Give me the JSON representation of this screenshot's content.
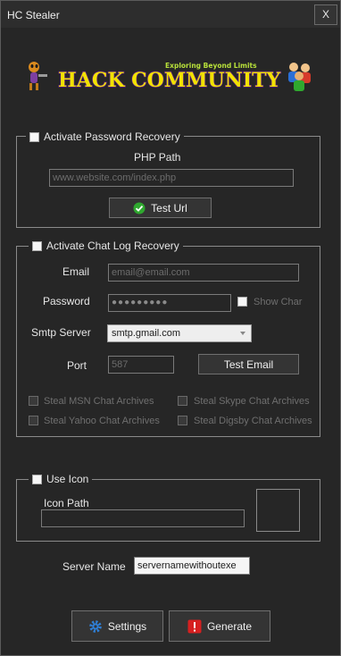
{
  "window": {
    "title": "HC Stealer",
    "close_label": "X"
  },
  "logo": {
    "tagline": "Exploring Beyond Limits",
    "brand": "HACK COMMUNITY"
  },
  "password_recovery": {
    "checkbox_label": "Activate Password Recovery",
    "php_path_label": "PHP Path",
    "php_path_placeholder": "www.website.com/index.php",
    "test_button": "Test Url"
  },
  "chat_log": {
    "checkbox_label": "Activate Chat Log Recovery",
    "email_label": "Email",
    "email_placeholder": "email@email.com",
    "password_label": "Password",
    "password_value": "●●●●●●●●●",
    "show_char_label": "Show Char",
    "smtp_label": "Smtp Server",
    "smtp_value": "smtp.gmail.com",
    "port_label": "Port",
    "port_value": "587",
    "test_email_button": "Test Email",
    "options": [
      "Steal MSN Chat Archives",
      "Steal Skype Chat Archives",
      "Steal Yahoo Chat Archives",
      "Steal Digsby Chat Archives"
    ]
  },
  "icon": {
    "checkbox_label": "Use Icon",
    "path_label": "Icon Path",
    "path_value": ""
  },
  "server": {
    "label": "Server Name",
    "value": "servernamewithoutexe"
  },
  "actions": {
    "settings": "Settings",
    "generate": "Generate"
  },
  "colors": {
    "background": "#262626",
    "success_icon": "#2fa82f",
    "generate_icon": "#d62020",
    "settings_icon": "#2f7fd6",
    "logo_text": "#f2e200"
  }
}
